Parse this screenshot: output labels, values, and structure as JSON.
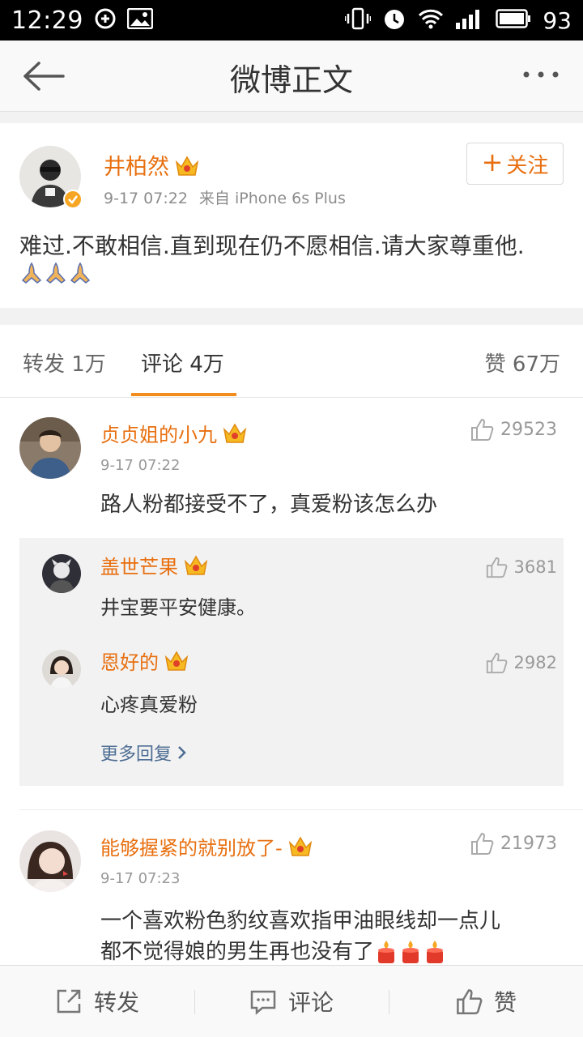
{
  "status_bar": {
    "time": "12:29",
    "battery": "93"
  },
  "nav": {
    "title": "微博正文"
  },
  "post": {
    "author": "井柏然",
    "date": "9-17 07:22",
    "source": "来自 iPhone 6s Plus",
    "follow_label": "关注",
    "text": "难过.不敢相信.直到现在仍不愿相信.请大家尊重他."
  },
  "tabs": {
    "repost": "转发 1万",
    "comment": "评论 4万",
    "like": "赞 67万"
  },
  "comments": [
    {
      "name": "贞贞姐的小九",
      "time": "9-17 07:22",
      "likes": "29523",
      "text": "路人粉都接受不了，真爱粉该怎么办",
      "replies": [
        {
          "name": "盖世芒果",
          "likes": "3681",
          "text": "井宝要平安健康。"
        },
        {
          "name": "恩好的",
          "likes": "2982",
          "text": "心疼真爱粉"
        }
      ],
      "more_replies": "更多回复"
    },
    {
      "name": "能够握紧的就别放了-",
      "time": "9-17 07:23",
      "likes": "21973",
      "text_line1": "一个喜欢粉色豹纹喜欢指甲油眼线却一点儿",
      "text_line2": "都不觉得娘的男生再也没有了"
    }
  ],
  "bottom_bar": {
    "repost": "转发",
    "comment": "评论",
    "like": "赞"
  },
  "colors": {
    "accent": "#f28c1c",
    "username": "#e86f0f",
    "link": "#4e6d93"
  }
}
